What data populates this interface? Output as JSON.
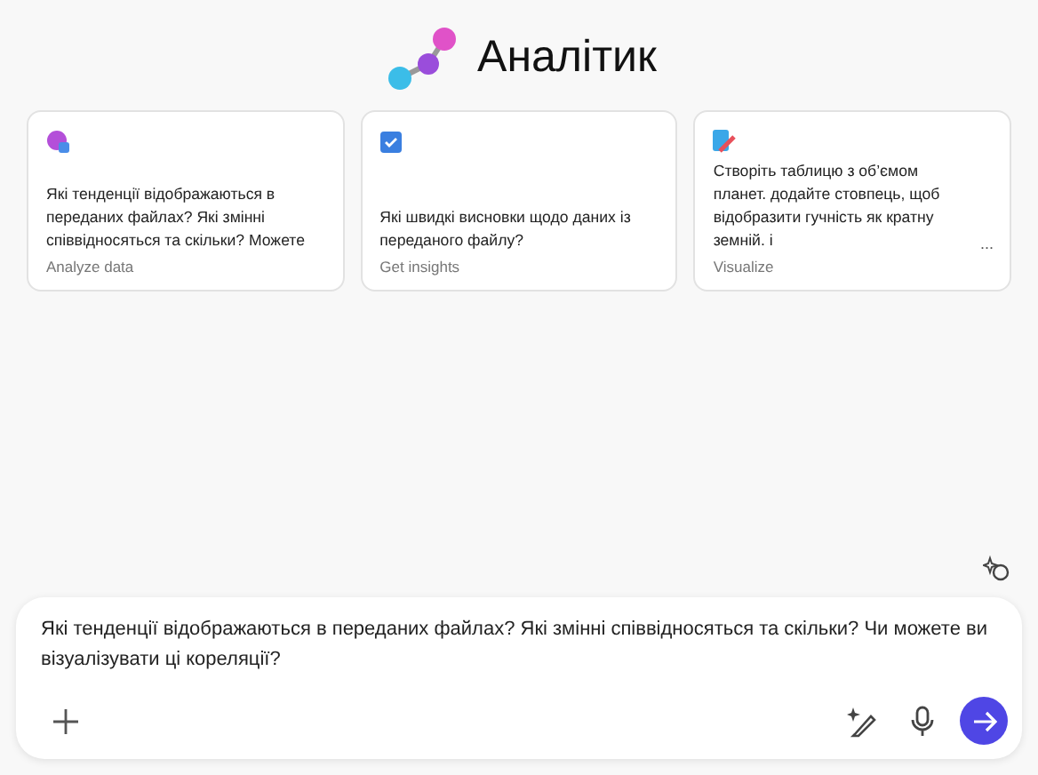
{
  "header": {
    "title": "Аналітик"
  },
  "cards": [
    {
      "kind": "analyze",
      "text": "Які тенденції відображаються в переданих файлах? Які змінні співвідносяться та скільки? Можете",
      "label": "Analyze data"
    },
    {
      "kind": "insights",
      "text": "Які швидкі висновки щодо даних із переданого файлу?",
      "label": "Get insights"
    },
    {
      "kind": "visualize",
      "text": "Створіть таблицю з об’ємом планет. додайте стовпець, щоб відобразити гучність як кратну земній. і",
      "more": "...",
      "label": "Visualize"
    }
  ],
  "composer": {
    "value": "Які тенденції відображаються в переданих файлах? Які змінні співвідносяться та скільки? Чи можете ви візуалізувати ці кореляції?"
  }
}
